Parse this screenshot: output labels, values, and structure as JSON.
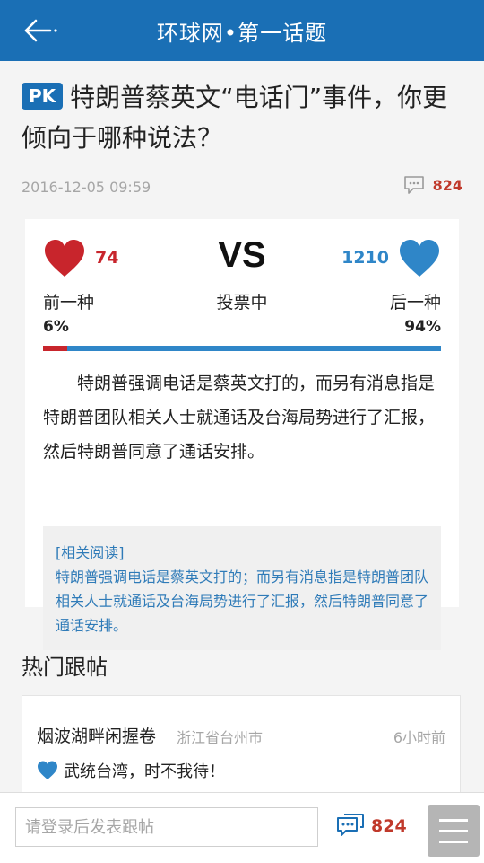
{
  "header": {
    "title": "环球网•第一话题",
    "back_icon": "back-arrow-icon"
  },
  "article": {
    "badge": "PK",
    "title": "特朗普蔡英文“电话门”事件，你更倾向于哪种说法？",
    "date": "2016-12-05 09:59",
    "comment_count": "824"
  },
  "vote": {
    "left": {
      "count": "74",
      "label": "前一种",
      "percent": "6%",
      "value": 0.06,
      "color": "#c8252c"
    },
    "center": {
      "vs": "VS",
      "status": "投票中"
    },
    "right": {
      "count": "1210",
      "label": "后一种",
      "percent": "94%",
      "value": 0.94,
      "color": "#2f86c8"
    }
  },
  "summary": "特朗普强调电话是蔡英文打的，而另有消息指是特朗普团队相关人士就通话及台海局势进行了汇报，然后特朗普同意了通话安排。",
  "related": {
    "title": "[相关阅读]",
    "body": "特朗普强调电话是蔡英文打的；而另有消息指是特朗普团队相关人士就通话及台海局势进行了汇报，然后特朗普同意了通话安排。"
  },
  "hot_posts": {
    "section_title": "热门跟帖",
    "items": [
      {
        "user": "烟波湖畔闲握卷",
        "location": "浙江省台州市",
        "time": "6小时前",
        "text": "武统台湾，时不我待！"
      }
    ]
  },
  "footer": {
    "input_placeholder": "请登录后发表跟帖",
    "comment_count": "824",
    "menu_icon": "menu-icon"
  }
}
